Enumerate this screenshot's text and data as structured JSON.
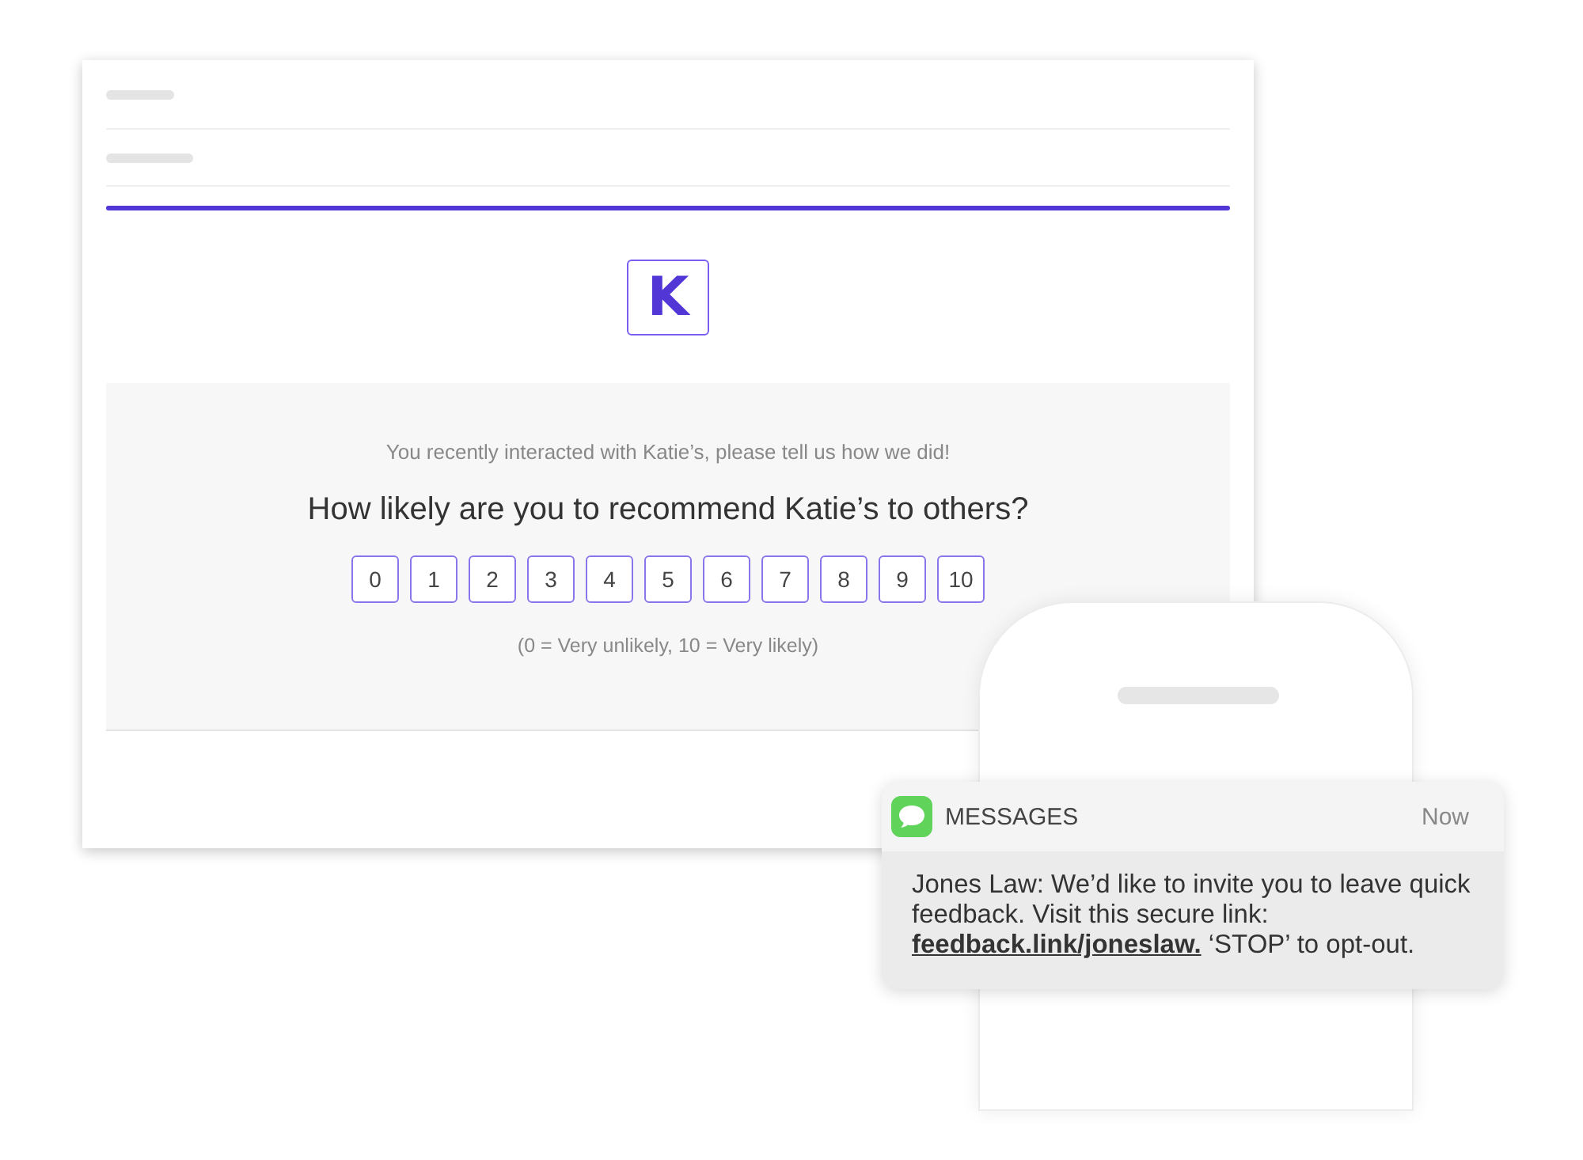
{
  "email": {
    "logo": "K",
    "intro": "You recently interacted with Katie’s, please tell us how we did!",
    "question": "How likely are you to recommend Katie’s to others?",
    "scale": [
      {
        "label": "0"
      },
      {
        "label": "1"
      },
      {
        "label": "2"
      },
      {
        "label": "3"
      },
      {
        "label": "4"
      },
      {
        "label": "5"
      },
      {
        "label": "6"
      },
      {
        "label": "7"
      },
      {
        "label": "8"
      },
      {
        "label": "9"
      },
      {
        "label": "10"
      }
    ],
    "legend": "(0 = Very unlikely, 10 = Very likely)"
  },
  "notification": {
    "app": "MESSAGES",
    "time": "Now",
    "text": "Jones Law: We’d like to invite you to leave quick feedback. Visit this secure link:",
    "link": "feedback.link/joneslaw.",
    "after": "‘STOP’ to opt-out."
  }
}
